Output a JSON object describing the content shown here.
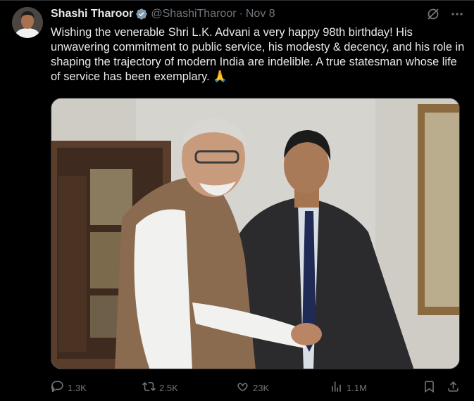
{
  "tweet": {
    "author_name": "Shashi Tharoor",
    "handle": "@ShashiTharoor",
    "separator": "·",
    "date": "Nov 8",
    "text": "Wishing the venerable Shri L.K. Advani a very happy 98th birthday! His unwavering commitment to public service, his modesty & decency, and his role in shaping the trajectory of modern India are indelible. A true statesman whose life of service has been exemplary. 🙏"
  },
  "actions": {
    "replies": "1.3K",
    "reposts": "2.5K",
    "likes": "23K",
    "views": "1.1M"
  },
  "colors": {
    "background": "#000000",
    "text": "#e7e9ea",
    "secondary": "#71767b",
    "verified_badge": "#829aab"
  },
  "icons": [
    "verified-icon",
    "grok-icon",
    "more-icon",
    "reply-icon",
    "repost-icon",
    "like-icon",
    "views-icon",
    "bookmark-icon",
    "share-icon"
  ]
}
